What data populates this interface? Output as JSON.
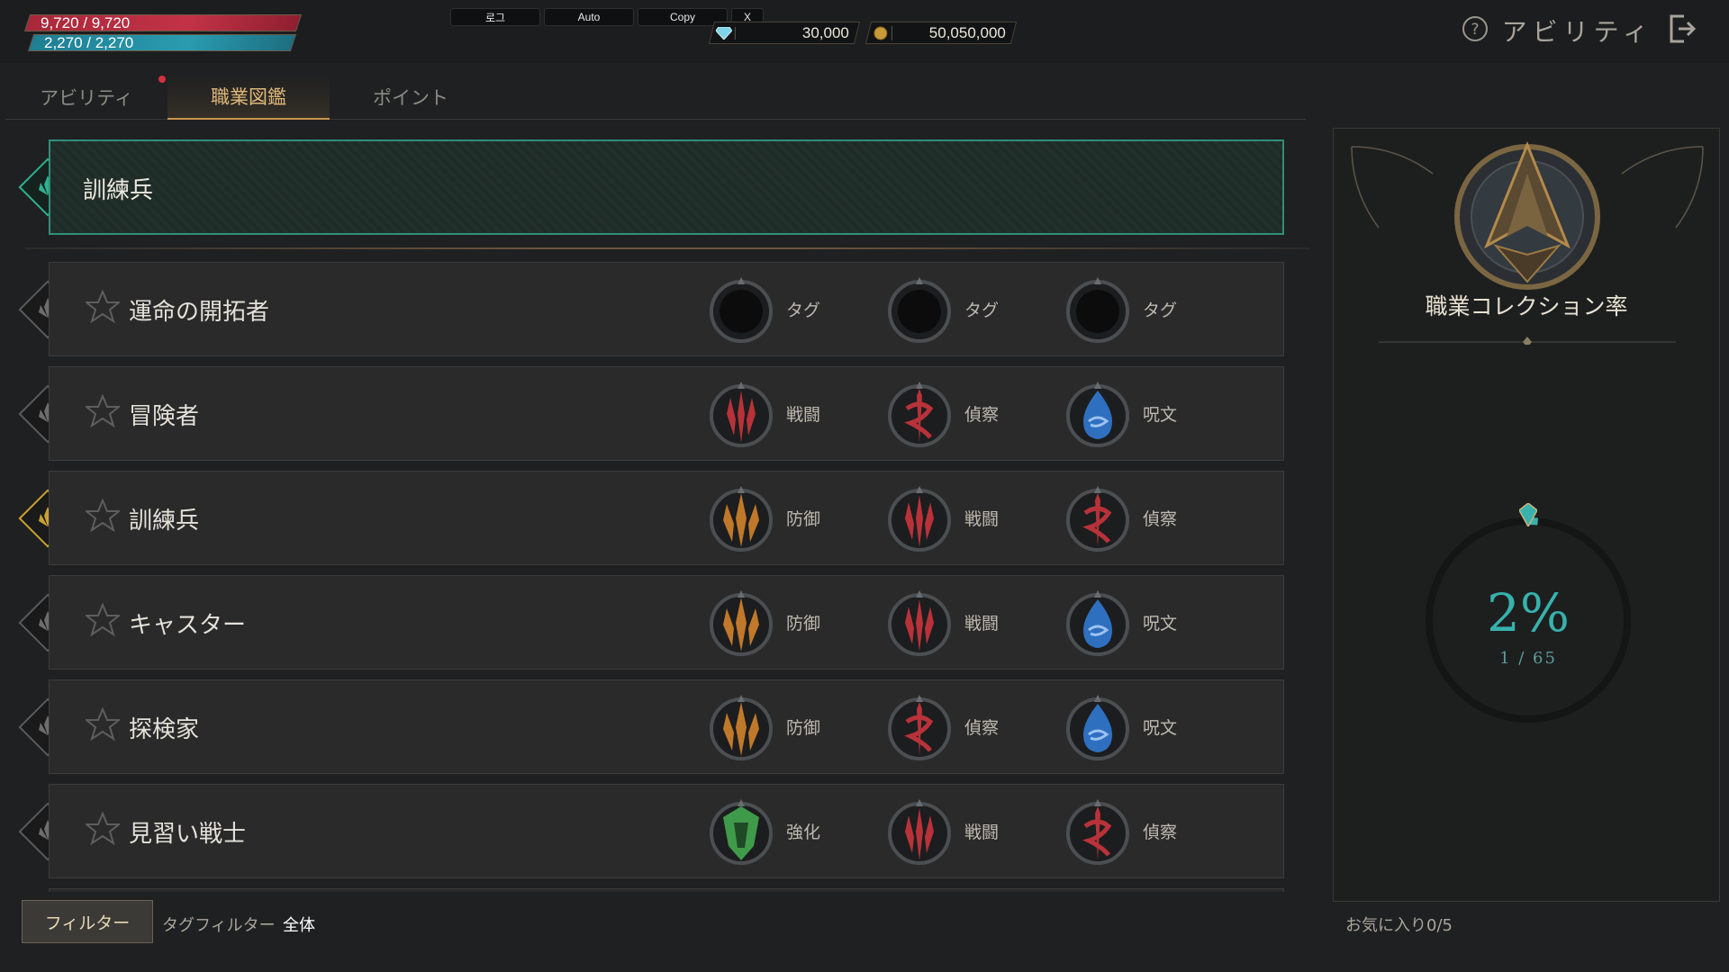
{
  "hud": {
    "hp": "9,720 / 9,720",
    "mp": "2,270 / 2,270",
    "debug_buttons": [
      "로그",
      "Auto",
      "Copy",
      "X"
    ],
    "gems": "30,000",
    "gold": "50,050,000",
    "title": "アビリティ"
  },
  "tabs": [
    {
      "label": "アビリティ",
      "notify": true
    },
    {
      "label": "職業図鑑",
      "active": true
    },
    {
      "label": "ポイント"
    }
  ],
  "selected": {
    "name": "訓練兵"
  },
  "jobs": [
    {
      "name": "運命の開拓者",
      "tags": [
        {
          "label": "タグ",
          "icon": "empty"
        },
        {
          "label": "タグ",
          "icon": "empty"
        },
        {
          "label": "タグ",
          "icon": "empty"
        }
      ]
    },
    {
      "name": "冒険者",
      "tags": [
        {
          "label": "戦闘",
          "icon": "combat"
        },
        {
          "label": "偵察",
          "icon": "recon"
        },
        {
          "label": "呪文",
          "icon": "spell"
        }
      ]
    },
    {
      "name": "訓練兵",
      "owned": true,
      "tags": [
        {
          "label": "防御",
          "icon": "defense"
        },
        {
          "label": "戦闘",
          "icon": "combat"
        },
        {
          "label": "偵察",
          "icon": "recon"
        }
      ]
    },
    {
      "name": "キャスター",
      "tags": [
        {
          "label": "防御",
          "icon": "defense"
        },
        {
          "label": "戦闘",
          "icon": "combat"
        },
        {
          "label": "呪文",
          "icon": "spell"
        }
      ]
    },
    {
      "name": "探検家",
      "tags": [
        {
          "label": "防御",
          "icon": "defense"
        },
        {
          "label": "偵察",
          "icon": "recon"
        },
        {
          "label": "呪文",
          "icon": "spell"
        }
      ]
    },
    {
      "name": "見習い戦士",
      "tags": [
        {
          "label": "強化",
          "icon": "buff"
        },
        {
          "label": "戦闘",
          "icon": "combat"
        },
        {
          "label": "偵察",
          "icon": "recon"
        }
      ]
    }
  ],
  "collection": {
    "title": "職業コレクション率",
    "percent_text": "2%",
    "count_text": "1 / 65",
    "ratio": 0.0154
  },
  "footer": {
    "filter_button": "フィルター",
    "tag_filter_label": "タグフィルター",
    "tag_filter_value": "全体",
    "favorites": "お気に入り0/5"
  },
  "colors": {
    "combat": "#b8323a",
    "recon": "#b8323a",
    "spell": "#2f6fc0",
    "defense": "#c0782a",
    "buff": "#3f9a4a",
    "accent": "#2fb08f"
  }
}
